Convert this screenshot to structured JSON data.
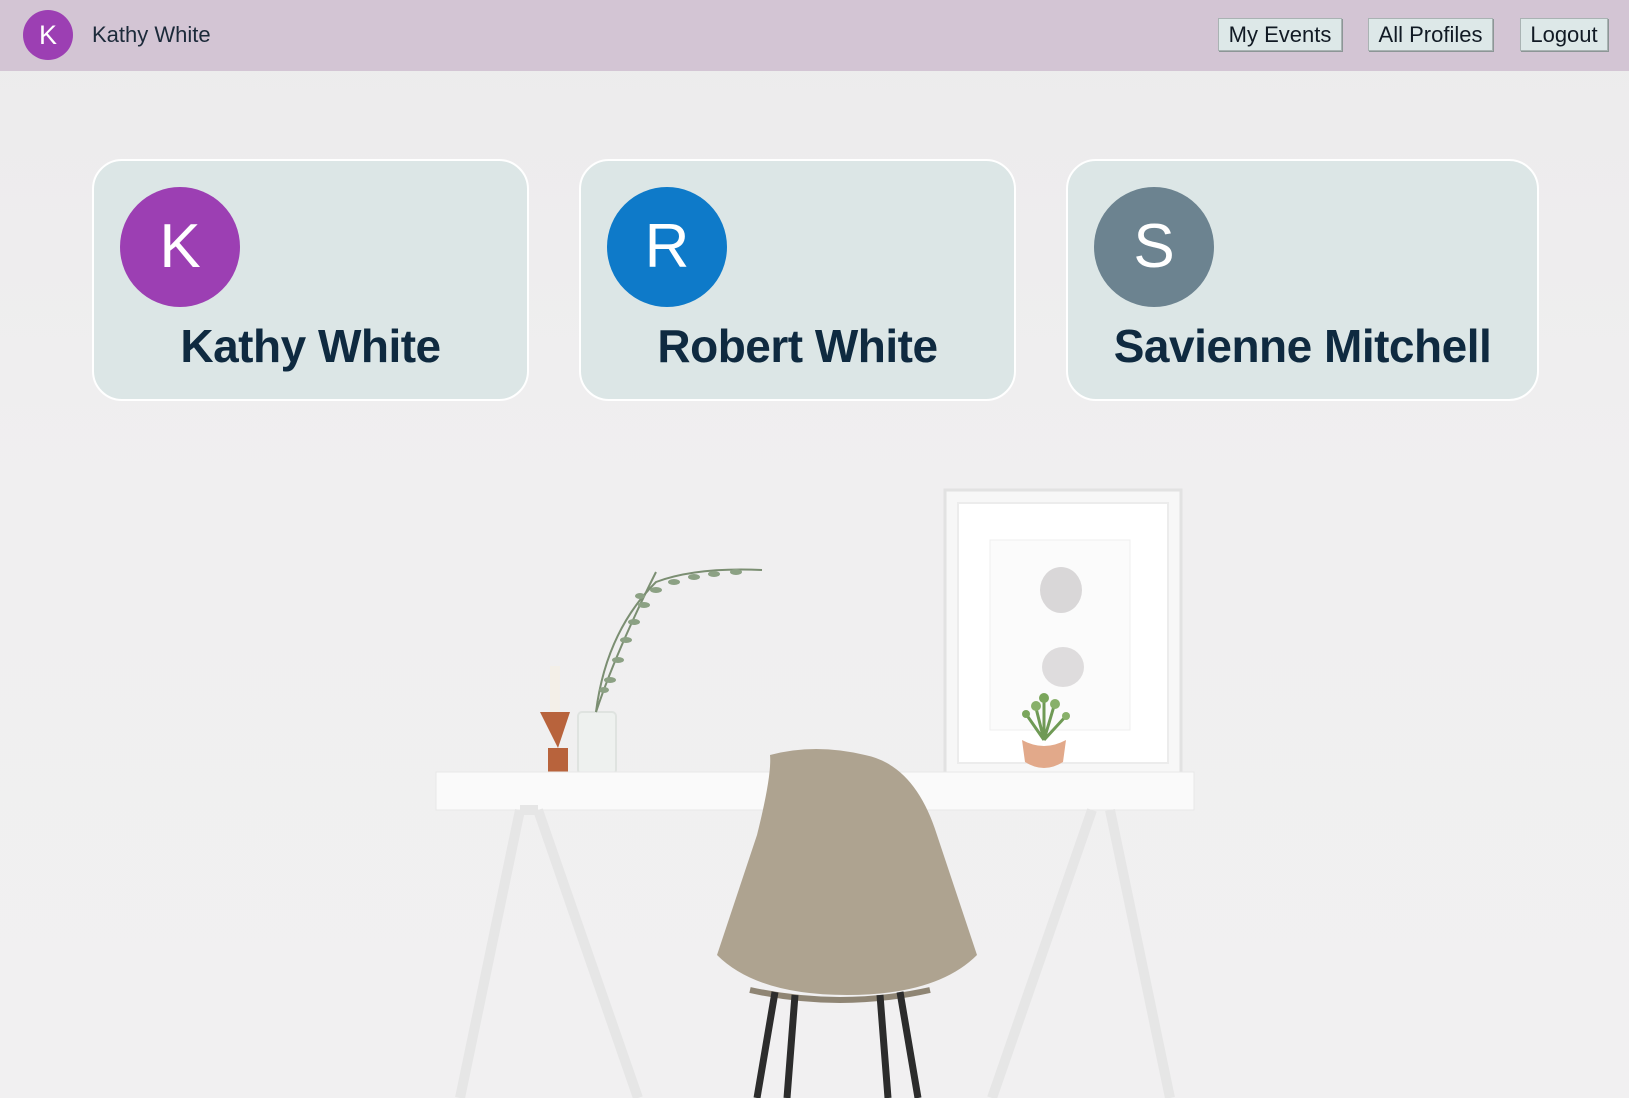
{
  "header": {
    "user": {
      "initial": "K",
      "name": "Kathy White",
      "color": "#9c3fb3"
    },
    "nav": {
      "my_events": "My Events",
      "all_profiles": "All Profiles",
      "logout": "Logout"
    }
  },
  "profiles": [
    {
      "initial": "K",
      "name": "Kathy White",
      "color": "#9c3fb3"
    },
    {
      "initial": "R",
      "name": "Robert White",
      "color": "#0e7ac9"
    },
    {
      "initial": "S",
      "name": "Savienne Mitchell",
      "color": "#6c8390"
    }
  ],
  "background": {
    "subject": "desk-with-chair-photo"
  }
}
